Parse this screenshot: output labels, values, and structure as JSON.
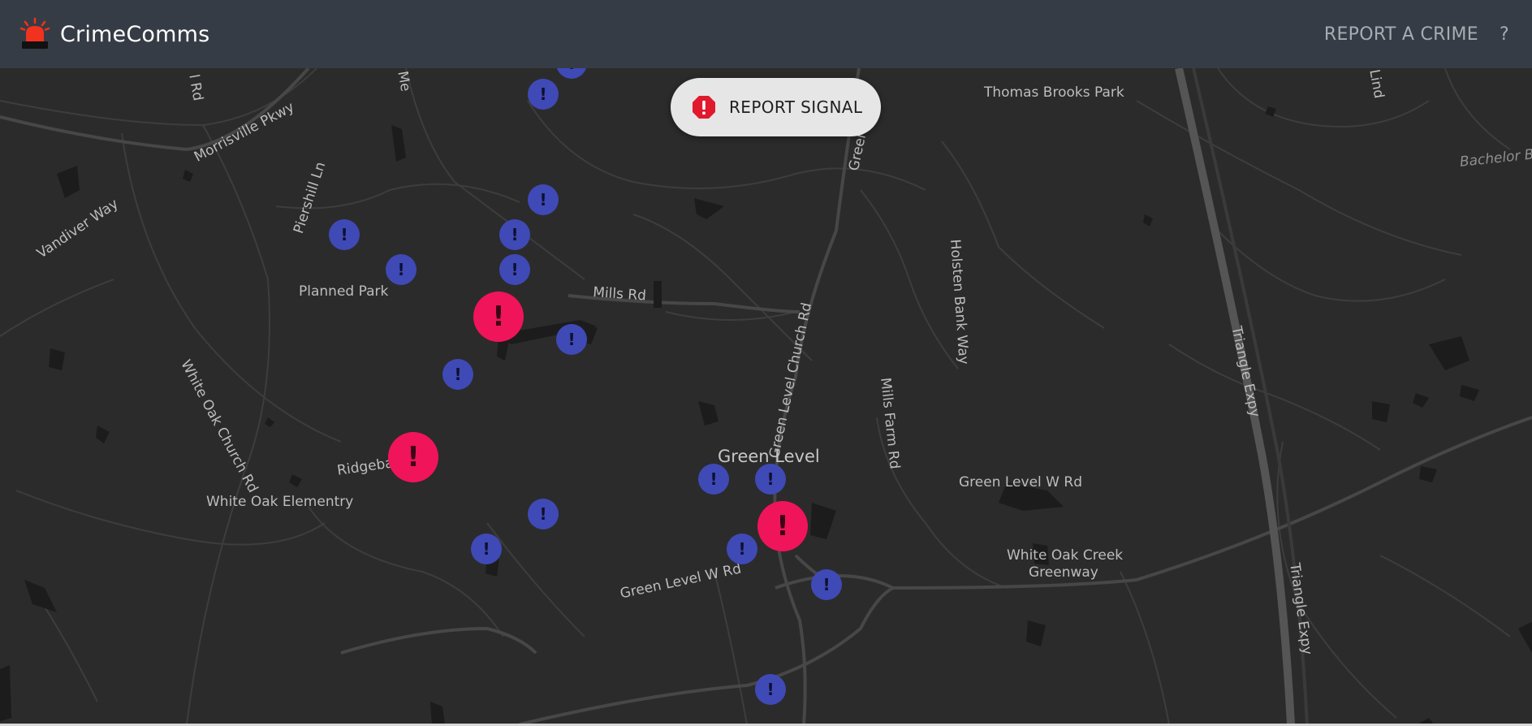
{
  "app": {
    "name": "CrimeComms",
    "logo_icon": "siren-icon"
  },
  "nav": {
    "report_crime_label": "REPORT A CRIME",
    "help_label": "?"
  },
  "report_signal": {
    "label": "REPORT SIGNAL",
    "icon": "alert-octagon-icon",
    "icon_color": "#e0192d"
  },
  "map": {
    "colors": {
      "background": "#2b2b2b",
      "road": "#454545",
      "highway": "#525252",
      "water": "#1a1a1a",
      "minor_marker": "#3f4ab6",
      "major_marker": "#f0145a"
    },
    "labels": {
      "thomas_brooks_park": "Thomas Brooks Park",
      "bachelor": "Bachelor Bl",
      "morrisville_pkwy": "Morrisville Pkwy",
      "piershill_ln": "Piershill Ln",
      "vandiver_way": "Vandiver Way",
      "planned_park": "Planned Park",
      "mills_rd": "Mills Rd",
      "white_oak_church_rd": "White Oak Church Rd",
      "green_level_church_rd": "Green Level Church Rd",
      "green_level_church_top": "Green Ch",
      "holsten_bank_way": "Holsten Bank Way",
      "mills_farm_rd": "Mills Farm Rd",
      "triangle_expy_1": "Triangle Expy",
      "triangle_expy_2": "Triangle Expy",
      "ridgeback_rd": "Ridgeback Rd",
      "green_level": "Green Level",
      "green_level_w_rd_1": "Green Level W Rd",
      "green_level_w_rd_2": "Green Level W Rd",
      "white_oak_elementary": "White Oak Elementry",
      "white_oak_creek_greenway_1": "White Oak Creek",
      "white_oak_creek_greenway_2": "Greenway",
      "top_rd_1": "l Rd",
      "top_rd_2": "Me",
      "top_rd_3": "Lind"
    },
    "marker_glyph": "!",
    "markers": [
      {
        "type": "minor"
      },
      {
        "type": "minor"
      },
      {
        "type": "minor"
      },
      {
        "type": "minor"
      },
      {
        "type": "minor"
      },
      {
        "type": "minor"
      },
      {
        "type": "minor"
      },
      {
        "type": "major"
      },
      {
        "type": "minor"
      },
      {
        "type": "minor"
      },
      {
        "type": "major"
      },
      {
        "type": "minor"
      },
      {
        "type": "minor"
      },
      {
        "type": "minor"
      },
      {
        "type": "minor"
      },
      {
        "type": "major"
      },
      {
        "type": "minor"
      },
      {
        "type": "minor"
      },
      {
        "type": "minor"
      }
    ]
  }
}
